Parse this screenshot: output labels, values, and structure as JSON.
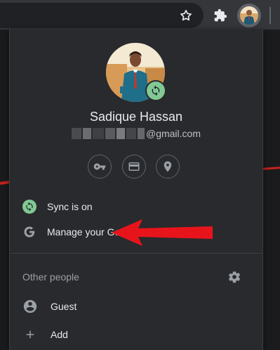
{
  "toolbar": {
    "star_icon": "star-outline-icon",
    "extensions_icon": "puzzle-piece-icon",
    "avatar_icon": "profile-avatar-icon"
  },
  "profile": {
    "name": "Sadique Hassan",
    "email_suffix": "@gmail.com",
    "sync_badge_color": "#81c995"
  },
  "quick_actions": [
    {
      "icon": "key-icon"
    },
    {
      "icon": "credit-card-icon"
    },
    {
      "icon": "location-pin-icon"
    }
  ],
  "menu": {
    "sync_label": "Sync is on",
    "manage_label": "Manage your Google Account"
  },
  "other_people": {
    "title": "Other people",
    "guest_label": "Guest",
    "add_label": "Add"
  },
  "colors": {
    "popup_bg": "#292a2d",
    "text": "#e8eaed",
    "muted": "#9aa0a6",
    "accent_green": "#81c995",
    "annotation_red": "#e8141b"
  }
}
